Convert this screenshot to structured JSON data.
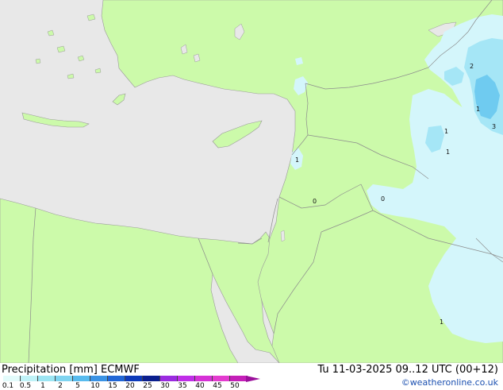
{
  "footer": {
    "title_left": "Precipitation [mm] ECMWF",
    "title_right": "Tu 11-03-2025 09..12 UTC (00+12)",
    "credit": "©weatheronline.co.uk"
  },
  "legend": {
    "labels": [
      "0.1",
      "0.5",
      "1",
      "2",
      "5",
      "10",
      "15",
      "20",
      "25",
      "30",
      "35",
      "40",
      "45",
      "50"
    ],
    "colors": [
      "#e3fbfb",
      "#bff2f7",
      "#9ce5f3",
      "#7fd4f0",
      "#58bbee",
      "#3b93e5",
      "#2166d6",
      "#0d3aba",
      "#0b1f8e",
      "#9b2be0",
      "#c02ee8",
      "#d631d6",
      "#e33bcf",
      "#c41fb8"
    ]
  },
  "map": {
    "colors": {
      "land": "#ccfaaa",
      "sea": "#e8e8e8",
      "outside_land": "#eaeaea",
      "border": "#8c8c8c",
      "rain_light": "#d4f6fb",
      "rain_medium": "#a5e6f6",
      "rain_heavy": "#6fcbf0"
    },
    "rain_marks": [
      "1",
      "1",
      "1",
      "2",
      "3",
      "1",
      "1",
      "0",
      "0"
    ]
  }
}
